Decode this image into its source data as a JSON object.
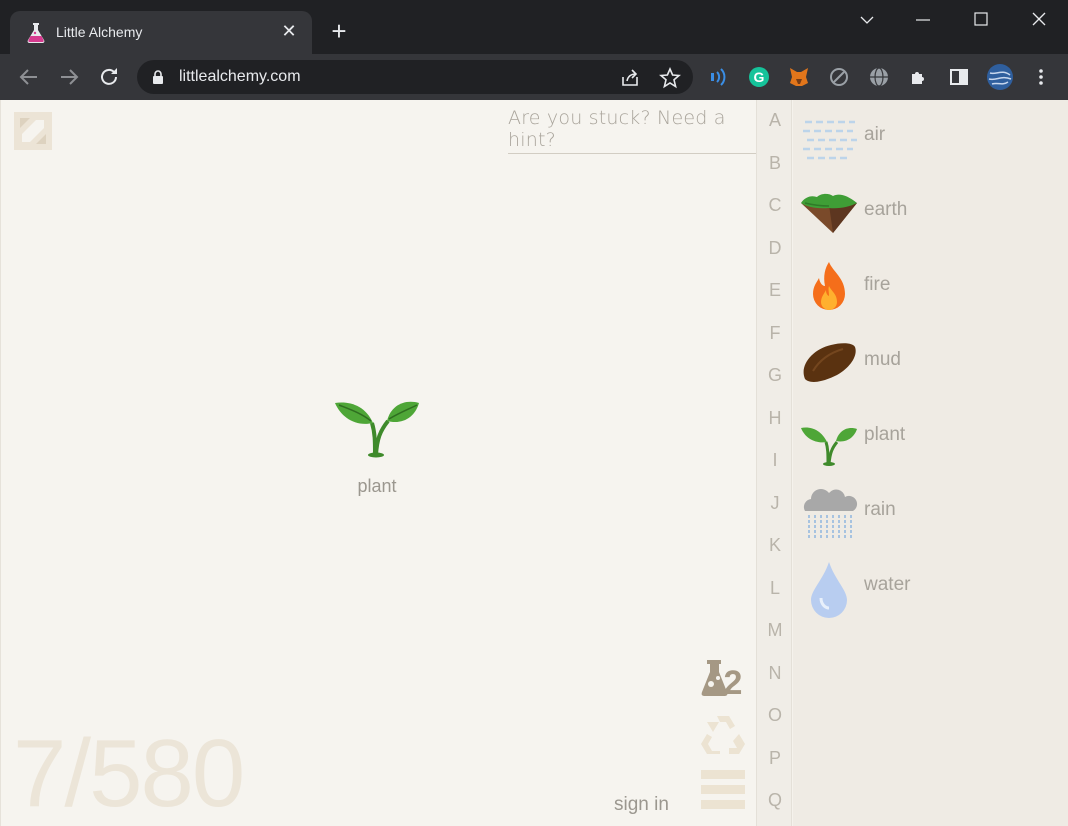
{
  "browser": {
    "tab_title": "Little Alchemy",
    "url": "littlealchemy.com"
  },
  "workspace": {
    "hint_link": "Are you stuck? Need a hint?",
    "element": {
      "name": "plant",
      "icon": "plant-icon"
    },
    "counter": "7/580",
    "signin": "sign in"
  },
  "alphabet": [
    "A",
    "B",
    "C",
    "D",
    "E",
    "F",
    "G",
    "H",
    "I",
    "J",
    "K",
    "L",
    "M",
    "N",
    "O",
    "P",
    "Q"
  ],
  "library": [
    {
      "name": "air",
      "icon": "air-icon"
    },
    {
      "name": "earth",
      "icon": "earth-icon"
    },
    {
      "name": "fire",
      "icon": "fire-icon"
    },
    {
      "name": "mud",
      "icon": "mud-icon"
    },
    {
      "name": "plant",
      "icon": "plant-icon"
    },
    {
      "name": "rain",
      "icon": "rain-icon"
    },
    {
      "name": "water",
      "icon": "water-icon"
    }
  ],
  "colors": {
    "page_bg": "#f6f4ef",
    "text_muted": "#9b978f",
    "counter": "#ece5d8"
  }
}
